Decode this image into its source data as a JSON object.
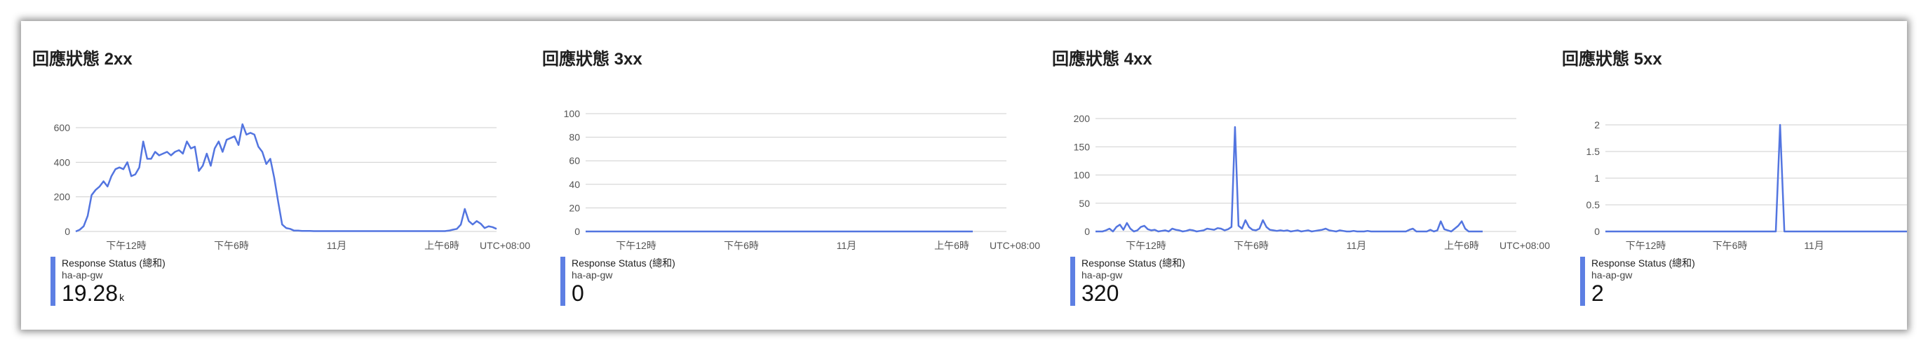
{
  "tz_label": "UTC+08:00",
  "chart_data": [
    {
      "type": "line",
      "title": "回應狀態 2xx",
      "yticks": [
        0,
        200,
        400,
        600
      ],
      "ylim": [
        0,
        600
      ],
      "xticks": [
        "下午12時",
        "下午6時",
        "11月",
        "上午6時"
      ],
      "grid": true,
      "legend_position": "bottom",
      "series": [
        {
          "name": "Response Status (總和)",
          "resource": "ha-ap-gw",
          "values": [
            0,
            10,
            30,
            90,
            210,
            240,
            260,
            290,
            260,
            320,
            360,
            370,
            360,
            400,
            320,
            330,
            370,
            520,
            420,
            420,
            460,
            440,
            450,
            460,
            440,
            460,
            470,
            450,
            520,
            480,
            490,
            350,
            380,
            450,
            380,
            480,
            520,
            460,
            530,
            540,
            550,
            500,
            620,
            560,
            570,
            560,
            490,
            460,
            390,
            420,
            310,
            170,
            40,
            20,
            15,
            5,
            5,
            3,
            3,
            3,
            2,
            2,
            2,
            2,
            2,
            2,
            2,
            2,
            2,
            2,
            2,
            2,
            2,
            2,
            2,
            2,
            2,
            2,
            2,
            2,
            2,
            2,
            2,
            2,
            2,
            2,
            2,
            2,
            2,
            2,
            2,
            2,
            2,
            2,
            5,
            10,
            15,
            40,
            130,
            60,
            40,
            60,
            45,
            20,
            30,
            25,
            15
          ]
        }
      ],
      "total": "19.28",
      "total_unit": "k"
    },
    {
      "type": "line",
      "title": "回應狀態 3xx",
      "yticks": [
        0,
        20,
        40,
        60,
        80,
        100
      ],
      "ylim": [
        0,
        100
      ],
      "xticks": [
        "下午12時",
        "下午6時",
        "11月",
        "上午6時"
      ],
      "grid": true,
      "legend_position": "bottom",
      "series": [
        {
          "name": "Response Status (總和)",
          "resource": "ha-ap-gw",
          "values": [
            0,
            0,
            0,
            0,
            0,
            0,
            0,
            0,
            0,
            0,
            0,
            0,
            0,
            0,
            0,
            0,
            0,
            0,
            0,
            0,
            0,
            0,
            0,
            0,
            0,
            0,
            0,
            0,
            0,
            0,
            0,
            0,
            0,
            0,
            0,
            0,
            0,
            0,
            0,
            0,
            0,
            0,
            0,
            0,
            0,
            0,
            0,
            0,
            0,
            0,
            0,
            0,
            0,
            0,
            0,
            0,
            0,
            0,
            0,
            0,
            0,
            0,
            0,
            0,
            0,
            0,
            0,
            0,
            0,
            0,
            0,
            0,
            0,
            0,
            0,
            0,
            0,
            0,
            0,
            0,
            0,
            0,
            0,
            0,
            0,
            0,
            0,
            0,
            0,
            0,
            0,
            0,
            0,
            0,
            0,
            0,
            0,
            0,
            0,
            0,
            0,
            0,
            0,
            0,
            0,
            0,
            0
          ]
        }
      ],
      "total": "0",
      "total_unit": ""
    },
    {
      "type": "line",
      "title": "回應狀態 4xx",
      "yticks": [
        0,
        50,
        100,
        150,
        200
      ],
      "ylim": [
        0,
        200
      ],
      "xticks": [
        "下午12時",
        "下午6時",
        "11月",
        "上午6時"
      ],
      "grid": true,
      "legend_position": "bottom",
      "series": [
        {
          "name": "Response Status (總和)",
          "resource": "ha-ap-gw",
          "values": [
            0,
            0,
            0,
            2,
            5,
            0,
            8,
            12,
            3,
            15,
            5,
            0,
            2,
            8,
            10,
            4,
            2,
            3,
            0,
            1,
            2,
            0,
            5,
            3,
            2,
            0,
            1,
            3,
            2,
            0,
            1,
            2,
            5,
            4,
            3,
            6,
            5,
            2,
            4,
            8,
            185,
            10,
            5,
            20,
            8,
            3,
            2,
            5,
            20,
            8,
            3,
            2,
            1,
            2,
            1,
            2,
            0,
            1,
            2,
            0,
            1,
            2,
            0,
            1,
            2,
            3,
            5,
            2,
            1,
            0,
            2,
            1,
            0,
            0,
            1,
            0,
            0,
            0,
            1,
            0,
            0,
            0,
            0,
            0,
            0,
            0,
            0,
            0,
            0,
            0,
            3,
            5,
            0,
            0,
            0,
            0,
            3,
            0,
            2,
            18,
            4,
            2,
            0,
            5,
            10,
            18,
            5,
            0,
            0,
            0,
            0,
            0
          ]
        }
      ],
      "total": "320",
      "total_unit": ""
    },
    {
      "type": "line",
      "title": "回應狀態 5xx",
      "yticks": [
        "0",
        "0.5",
        "1",
        "1.5",
        "2"
      ],
      "ylim": [
        0,
        2
      ],
      "xticks": [
        "下午12時",
        "下午6時",
        "11月"
      ],
      "grid": true,
      "legend_position": "bottom",
      "series": [
        {
          "name": "Response Status (總和)",
          "resource": "ha-ap-gw",
          "values": [
            0,
            0,
            0,
            0,
            0,
            0,
            0,
            0,
            0,
            0,
            0,
            0,
            0,
            0,
            0,
            0,
            0,
            0,
            0,
            0,
            0,
            0,
            0,
            0,
            0,
            0,
            0,
            0,
            0,
            0,
            0,
            0,
            0,
            0,
            0,
            0,
            0,
            0,
            0,
            0,
            0,
            2,
            0,
            0,
            0,
            0,
            0,
            0,
            0,
            0,
            0,
            0,
            0,
            0,
            0,
            0,
            0,
            0,
            0,
            0,
            0,
            0,
            0,
            0,
            0,
            0,
            0,
            0,
            0,
            0,
            0,
            0,
            0,
            0,
            0,
            0,
            0,
            0,
            0,
            0
          ]
        }
      ],
      "total": "2",
      "total_unit": ""
    }
  ]
}
